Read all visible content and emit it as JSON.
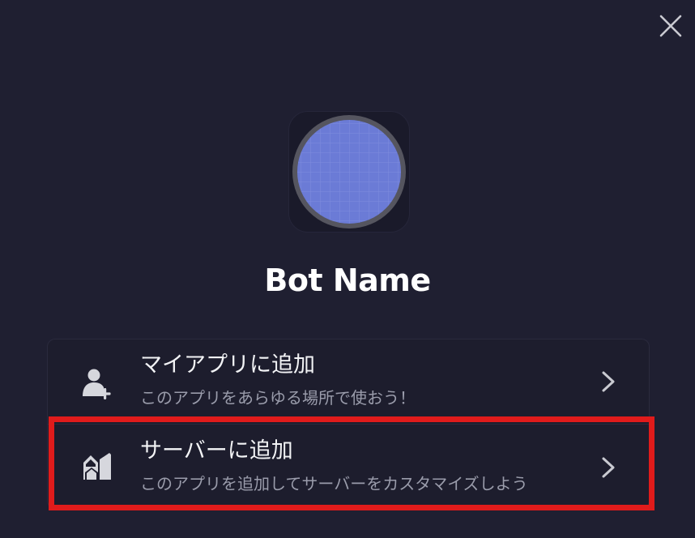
{
  "bot": {
    "name": "Bot Name"
  },
  "options": [
    {
      "title": "マイアプリに追加",
      "subtitle": "このアプリをあらゆる場所で使おう！",
      "icon": "user-plus-icon"
    },
    {
      "title": "サーバーに追加",
      "subtitle": "このアプリを追加してサーバーをカスタマイズしよう",
      "icon": "server-icon"
    }
  ],
  "colors": {
    "background": "#1f1f31",
    "avatar_fill": "#6b7bd6",
    "avatar_ring": "#55555f",
    "highlight": "#e01b1b",
    "title_text": "#f2f3f5",
    "subtitle_text": "#9a9cab"
  }
}
